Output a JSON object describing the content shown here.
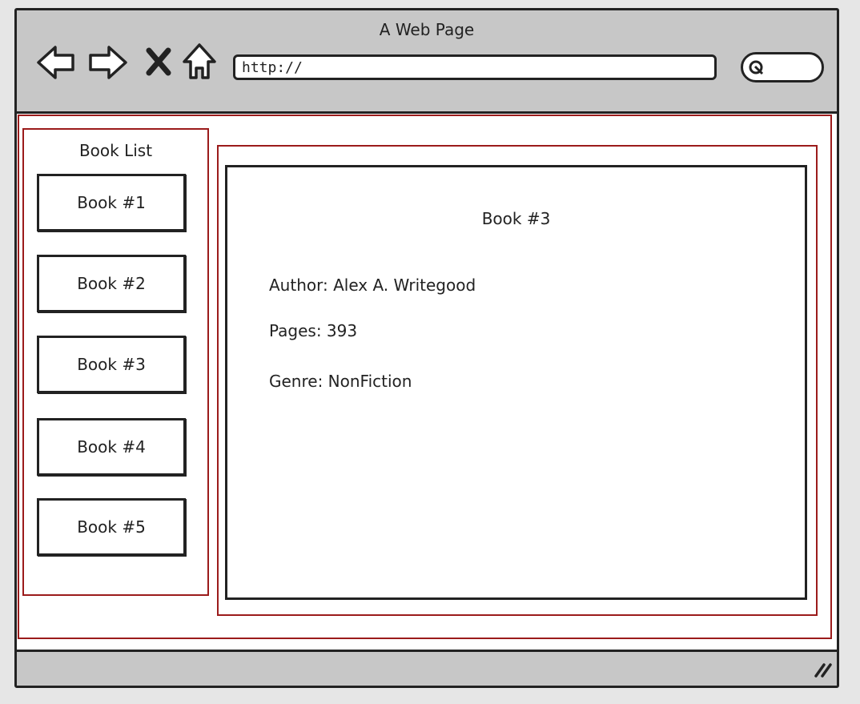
{
  "browser": {
    "title": "A Web Page",
    "url": "http://",
    "icons": {
      "back": "back-arrow-icon",
      "forward": "forward-arrow-icon",
      "stop": "close-icon",
      "home": "home-icon",
      "search": "search-icon",
      "resize": "resize-grip-icon"
    }
  },
  "sidebar": {
    "title": "Book List",
    "items": [
      {
        "label": "Book #1"
      },
      {
        "label": "Book #2"
      },
      {
        "label": "Book #3"
      },
      {
        "label": "Book #4"
      },
      {
        "label": "Book #5"
      }
    ]
  },
  "detail": {
    "title": "Book #3",
    "author": "Author: Alex A. Writegood",
    "pages": "Pages: 393",
    "genre": "Genre: NonFiction"
  },
  "colors": {
    "frame": "#9b1b1b",
    "chrome": "#c7c7c7",
    "ink": "#222222"
  }
}
